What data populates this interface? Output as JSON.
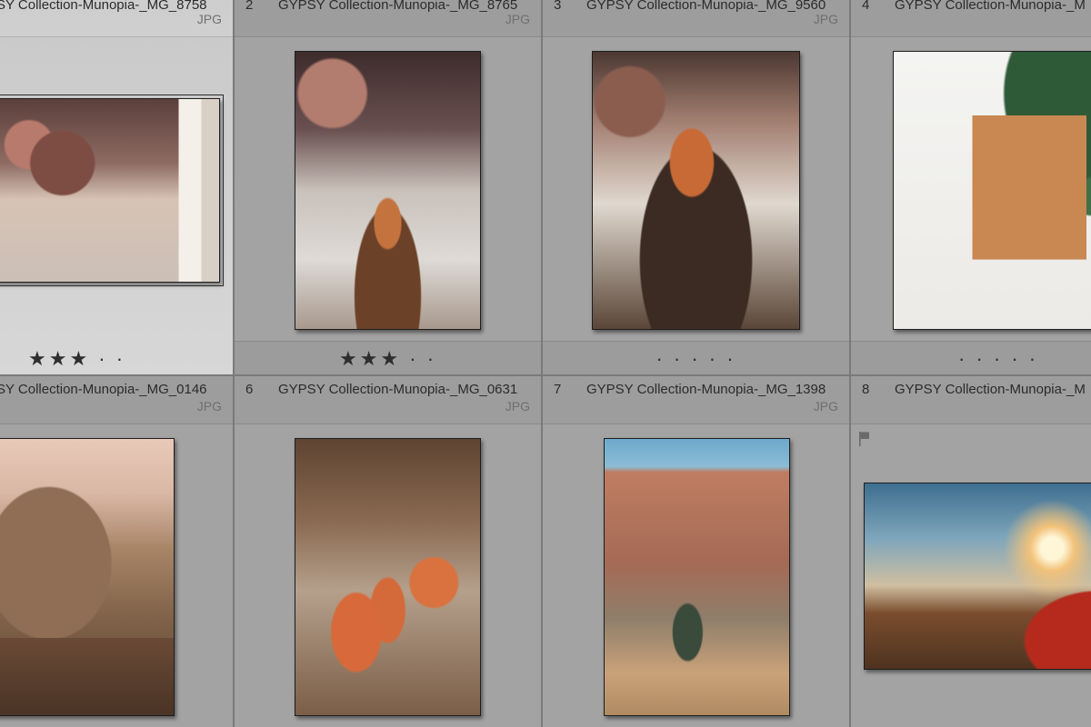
{
  "grid": {
    "cells": [
      {
        "index": "",
        "filename": "SY Collection-Munopia-_MG_8758",
        "filetype": "JPG",
        "rating": "★★★ · ·",
        "selected": true
      },
      {
        "index": "2",
        "filename": "GYPSY Collection-Munopia-_MG_8765",
        "filetype": "JPG",
        "rating": "★★★ · ·"
      },
      {
        "index": "3",
        "filename": "GYPSY Collection-Munopia-_MG_9560",
        "filetype": "JPG",
        "rating": "· · · · ·"
      },
      {
        "index": "4",
        "filename": "GYPSY Collection-Munopia-_M",
        "filetype": "",
        "rating": "· · · · ·"
      },
      {
        "index": "",
        "filename": "SY Collection-Munopia-_MG_0146",
        "filetype": "JPG",
        "rating": ""
      },
      {
        "index": "6",
        "filename": "GYPSY Collection-Munopia-_MG_0631",
        "filetype": "JPG",
        "rating": ""
      },
      {
        "index": "7",
        "filename": "GYPSY Collection-Munopia-_MG_1398",
        "filetype": "JPG",
        "rating": ""
      },
      {
        "index": "8",
        "filename": "GYPSY Collection-Munopia-_M",
        "filetype": "",
        "rating": "",
        "flag_icon": "flag-icon"
      }
    ]
  }
}
